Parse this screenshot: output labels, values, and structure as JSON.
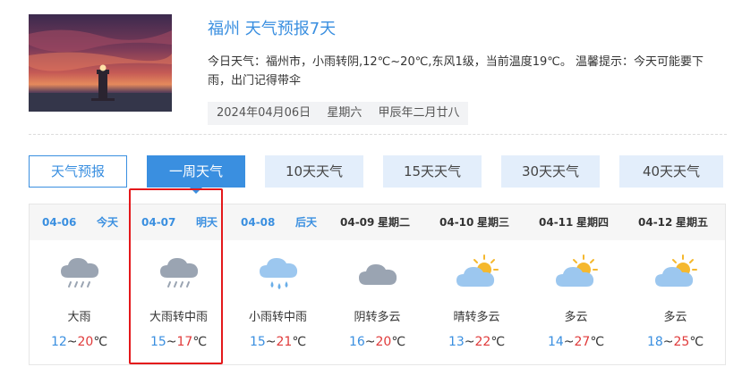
{
  "header": {
    "title": "福州 天气预报7天",
    "description": "今日天气：福州市，小雨转阴,12℃~20℃,东风1级，当前温度19℃。 温馨提示：今天可能要下雨，出门记得带伞",
    "date": "2024年04月06日",
    "weekday": "星期六",
    "lunar": "甲辰年二月廿八"
  },
  "tabs": [
    {
      "label": "天气预报"
    },
    {
      "label": "一周天气"
    },
    {
      "label": "10天天气"
    },
    {
      "label": "15天天气"
    },
    {
      "label": "30天天气"
    },
    {
      "label": "40天天气"
    }
  ],
  "days": [
    {
      "date": "04-06",
      "weekday": "今天",
      "weather": "大雨",
      "low": "12",
      "high": "20",
      "unit": "℃",
      "icon": "heavy-rain-icon"
    },
    {
      "date": "04-07",
      "weekday": "明天",
      "weather": "大雨转中雨",
      "low": "15",
      "high": "17",
      "unit": "℃",
      "icon": "heavy-rain-icon"
    },
    {
      "date": "04-08",
      "weekday": "后天",
      "weather": "小雨转中雨",
      "low": "15",
      "high": "21",
      "unit": "℃",
      "icon": "light-rain-icon"
    },
    {
      "date": "04-09",
      "weekday": "星期二",
      "weather": "阴转多云",
      "low": "16",
      "high": "20",
      "unit": "℃",
      "icon": "overcast-icon"
    },
    {
      "date": "04-10",
      "weekday": "星期三",
      "weather": "晴转多云",
      "low": "13",
      "high": "22",
      "unit": "℃",
      "icon": "partly-cloudy-icon"
    },
    {
      "date": "04-11",
      "weekday": "星期四",
      "weather": "多云",
      "low": "14",
      "high": "27",
      "unit": "℃",
      "icon": "partly-cloudy-icon"
    },
    {
      "date": "04-12",
      "weekday": "星期五",
      "weather": "多云",
      "low": "18",
      "high": "25",
      "unit": "℃",
      "icon": "partly-cloudy-icon"
    }
  ],
  "colors": {
    "accent": "#3a8fe0",
    "tab_light_bg": "#e3eefb",
    "temp_low": "#3a8fe0",
    "temp_high": "#e03a3a",
    "highlight_box": "#e4181b"
  }
}
